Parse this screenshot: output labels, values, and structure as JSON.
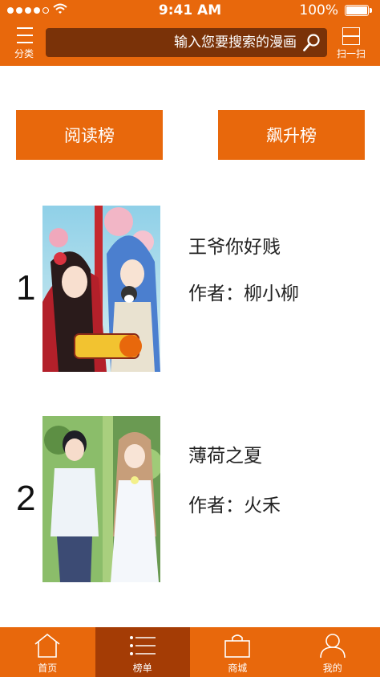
{
  "status_bar": {
    "time": "9:41 AM",
    "battery": "100%"
  },
  "header": {
    "category_label": "分类",
    "search_placeholder": "输入您要搜索的漫画",
    "scan_label": "扫一扫"
  },
  "tabs": {
    "read_rank": "阅读榜",
    "rising_rank": "飙升榜"
  },
  "rankings": [
    {
      "rank": "1",
      "title": "王爷你好贱",
      "author": "作者：柳小柳"
    },
    {
      "rank": "2",
      "title": "薄荷之夏",
      "author": "作者：火禾"
    }
  ],
  "bottom_nav": [
    {
      "label": "首页",
      "icon": "home-icon"
    },
    {
      "label": "榜单",
      "icon": "list-icon",
      "active": true
    },
    {
      "label": "商城",
      "icon": "shopping-bag-icon"
    },
    {
      "label": "我的",
      "icon": "user-icon"
    }
  ],
  "colors": {
    "brand": "#e8680c",
    "search_bg": "#7a3208",
    "nav_active": "#a43c05"
  }
}
